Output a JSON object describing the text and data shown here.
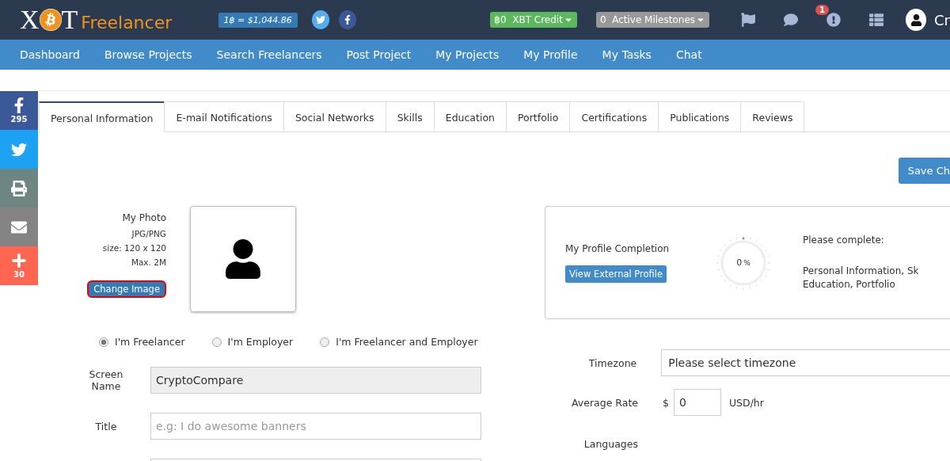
{
  "header": {
    "logo": {
      "letter_1": "X",
      "letter_2": "T",
      "word": "Freelancer"
    },
    "rate": "1฿ = $1,044.86",
    "credit": {
      "amount": "฿0",
      "label": "XBT Credit"
    },
    "milestones": {
      "count": "0",
      "label": "Active Milestones"
    },
    "alerts_badge": "1",
    "user_name": "Cr"
  },
  "nav": [
    "Dashboard",
    "Browse Projects",
    "Search Freelancers",
    "Post Project",
    "My Projects",
    "My Profile",
    "My Tasks",
    "Chat"
  ],
  "share_bar": [
    {
      "kind": "facebook",
      "count": "295"
    },
    {
      "kind": "twitter"
    },
    {
      "kind": "print"
    },
    {
      "kind": "email"
    },
    {
      "kind": "more",
      "count": "30"
    }
  ],
  "tabs": [
    {
      "label": "Personal Information",
      "selected": true
    },
    {
      "label": "E-mail Notifications",
      "selected": false
    },
    {
      "label": "Social Networks",
      "selected": false
    },
    {
      "label": "Skills",
      "selected": false
    },
    {
      "label": "Education",
      "selected": false
    },
    {
      "label": "Portfolio",
      "selected": false
    },
    {
      "label": "Certifications",
      "selected": false
    },
    {
      "label": "Publications",
      "selected": false
    },
    {
      "label": "Reviews",
      "selected": false
    }
  ],
  "save_button": "Save Ch",
  "photo": {
    "title": "My Photo",
    "format": "JPG/PNG",
    "size": "size: 120 x 120",
    "max": "Max. 2M",
    "button": "Change Image"
  },
  "profile_completion": {
    "title": "My Profile Completion",
    "button": "View External Profile",
    "percent": "0",
    "unit": "%",
    "prompt": "Please complete:",
    "missing_lines": [
      "Personal Information, Sk",
      "Education, Portfolio"
    ]
  },
  "account_type": [
    {
      "label": "I'm Freelancer",
      "selected": true
    },
    {
      "label": "I'm Employer",
      "selected": false
    },
    {
      "label": "I'm Freelancer and Employer",
      "selected": false
    }
  ],
  "left_form": [
    {
      "label": "Screen Name",
      "value": "CryptoCompare",
      "disabled": true
    },
    {
      "label": "Title",
      "placeholder": "e.g: I do awesome banners",
      "disabled": false
    },
    {
      "disabled": false
    }
  ],
  "right_form": {
    "timezone": {
      "label": "Timezone",
      "value": "Please select timezone"
    },
    "rate": {
      "label": "Average Rate",
      "currency": "$",
      "value": "0",
      "unit": "USD/hr"
    },
    "languages_label": "Languages"
  }
}
